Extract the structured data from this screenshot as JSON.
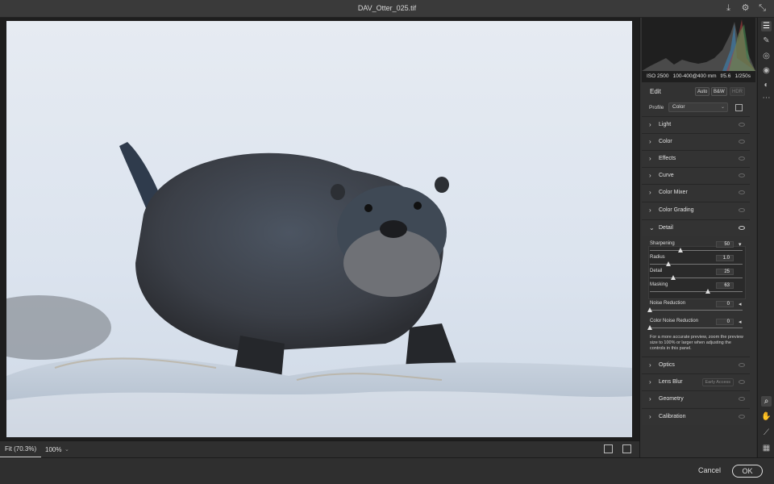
{
  "window": {
    "title": "DAV_Otter_025.tif"
  },
  "histogram_meta": {
    "iso": "ISO 2500",
    "lens": "100-400@400 mm",
    "aperture": "f/5.6",
    "shutter": "1/250s"
  },
  "edit": {
    "label": "Edit",
    "auto": "Auto",
    "bw": "B&W",
    "hdr": "HDR",
    "profile_label": "Profile",
    "profile_value": "Color"
  },
  "sections": {
    "light": "Light",
    "color": "Color",
    "effects": "Effects",
    "curve": "Curve",
    "color_mixer": "Color Mixer",
    "color_grading": "Color Grading",
    "detail": "Detail",
    "optics": "Optics",
    "lens_blur": "Lens Blur",
    "lens_blur_badge": "Early Access",
    "geometry": "Geometry",
    "calibration": "Calibration"
  },
  "detail": {
    "sharpening": {
      "label": "Sharpening",
      "value": "50"
    },
    "radius": {
      "label": "Radius",
      "value": "1.0"
    },
    "detail": {
      "label": "Detail",
      "value": "25"
    },
    "masking": {
      "label": "Masking",
      "value": "63"
    },
    "noise_reduction": {
      "label": "Noise Reduction",
      "value": "0"
    },
    "color_noise_reduction": {
      "label": "Color Noise Reduction",
      "value": "0"
    },
    "note": "For a more accurate preview, zoom the preview size to 100% or larger when adjusting the controls in this panel."
  },
  "bottom": {
    "fit": "Fit (70.3%)",
    "zoom": "100%"
  },
  "footer": {
    "cancel": "Cancel",
    "ok": "OK"
  }
}
